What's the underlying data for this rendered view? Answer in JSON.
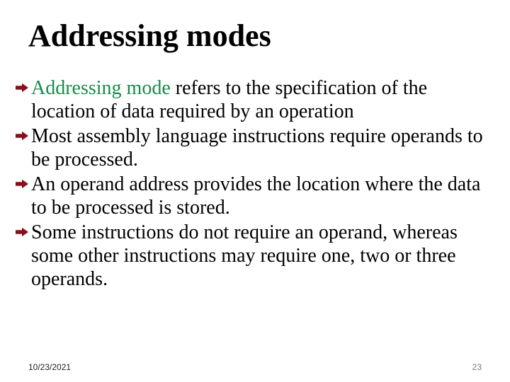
{
  "title": "Addressing modes",
  "bullets": [
    {
      "keyword": "Addressing mode",
      "rest": " refers to the specification of the location of data required by an operation"
    },
    {
      "keyword": "",
      "rest": "Most assembly language instructions require operands to be processed."
    },
    {
      "keyword": "",
      "rest": "An operand address provides the location where the data to be processed is stored."
    },
    {
      "keyword": "",
      "rest": "Some instructions do not require an operand, whereas some other instructions may require one, two or three operands."
    }
  ],
  "footer": {
    "date": "10/23/2021",
    "page": "23"
  },
  "colors": {
    "arrow_fill": "#8a0f1a",
    "keyword": "#1a8a4a"
  }
}
